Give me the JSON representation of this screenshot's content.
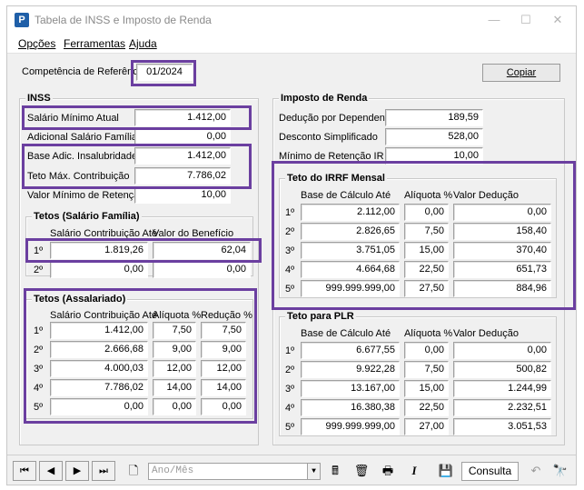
{
  "window": {
    "title": "Tabela de INSS e Imposto de Renda",
    "app_icon": "P",
    "minimize": "—",
    "maximize": "☐",
    "close": "✕"
  },
  "menu": [
    "Opções",
    "Ferramentas",
    "Ajuda"
  ],
  "competencia": {
    "label": "Competência de Referência",
    "value": "01/2024"
  },
  "copiar_label": "Copiar",
  "inss": {
    "title": "INSS",
    "fields": [
      {
        "label": "Salário Mínimo Atual",
        "value": "1.412,00"
      },
      {
        "label": "Adicional Salário Família",
        "value": "0,00"
      },
      {
        "label": "Base Adic. Insalubridade",
        "value": "1.412,00"
      },
      {
        "label": "Teto Máx. Contribuição",
        "value": "7.786,02"
      },
      {
        "label": "Valor Mínimo de Retenção",
        "value": "10,00"
      }
    ]
  },
  "tetos_familia": {
    "title": "Tetos (Salário Família)",
    "headers": [
      "Salário Contribuição Até",
      "Valor do Benefício"
    ],
    "rows": [
      {
        "idx": "1º",
        "salario": "1.819,26",
        "beneficio": "62,04"
      },
      {
        "idx": "2º",
        "salario": "0,00",
        "beneficio": "0,00"
      }
    ]
  },
  "tetos_assalariado": {
    "title": "Tetos (Assalariado)",
    "headers": [
      "Salário Contribuição Até",
      "Alíquota %",
      "Redução %"
    ],
    "rows": [
      {
        "idx": "1º",
        "salario": "1.412,00",
        "aliquota": "7,50",
        "reducao": "7,50"
      },
      {
        "idx": "2º",
        "salario": "2.666,68",
        "aliquota": "9,00",
        "reducao": "9,00"
      },
      {
        "idx": "3º",
        "salario": "4.000,03",
        "aliquota": "12,00",
        "reducao": "12,00"
      },
      {
        "idx": "4º",
        "salario": "7.786,02",
        "aliquota": "14,00",
        "reducao": "14,00"
      },
      {
        "idx": "5º",
        "salario": "0,00",
        "aliquota": "0,00",
        "reducao": "0,00"
      }
    ]
  },
  "imposto_renda": {
    "title": "Imposto de Renda",
    "fields": [
      {
        "label": "Dedução por Dependente",
        "value": "189,59"
      },
      {
        "label": "Desconto Simplificado",
        "value": "528,00"
      },
      {
        "label": "Mínimo de Retenção IR",
        "value": "10,00"
      }
    ]
  },
  "teto_irrf": {
    "title": "Teto do IRRF Mensal",
    "headers": [
      "Base de Cálculo Até",
      "Alíquota %",
      "Valor Dedução"
    ],
    "rows": [
      {
        "idx": "1º",
        "base": "2.112,00",
        "aliquota": "0,00",
        "deducao": "0,00"
      },
      {
        "idx": "2º",
        "base": "2.826,65",
        "aliquota": "7,50",
        "deducao": "158,40"
      },
      {
        "idx": "3º",
        "base": "3.751,05",
        "aliquota": "15,00",
        "deducao": "370,40"
      },
      {
        "idx": "4º",
        "base": "4.664,68",
        "aliquota": "22,50",
        "deducao": "651,73"
      },
      {
        "idx": "5º",
        "base": "999.999.999,00",
        "aliquota": "27,50",
        "deducao": "884,96"
      }
    ]
  },
  "teto_plr": {
    "title": "Teto para PLR",
    "headers": [
      "Base de Cálculo Até",
      "Alíquota %",
      "Valor Dedução"
    ],
    "rows": [
      {
        "idx": "1º",
        "base": "6.677,55",
        "aliquota": "0,00",
        "deducao": "0,00"
      },
      {
        "idx": "2º",
        "base": "9.922,28",
        "aliquota": "7,50",
        "deducao": "500,82"
      },
      {
        "idx": "3º",
        "base": "13.167,00",
        "aliquota": "15,00",
        "deducao": "1.244,99"
      },
      {
        "idx": "4º",
        "base": "16.380,38",
        "aliquota": "22,50",
        "deducao": "2.232,51"
      },
      {
        "idx": "5º",
        "base": "999.999.999,00",
        "aliquota": "27,00",
        "deducao": "3.051,53"
      }
    ]
  },
  "bottom": {
    "nav": [
      "⏮",
      "◀",
      "▶",
      "⏭"
    ],
    "combo_placeholder": "Ano/Mês",
    "combo_arrow": "▼",
    "consulta_label": "Consulta",
    "icons": {
      "new": "🗋",
      "calculator": "🖩",
      "cleaner": "🗑",
      "printer": "🖶",
      "italic": "I",
      "save": "💾",
      "undo": "↶",
      "binoculars": "🔭"
    }
  },
  "colors": {
    "highlight": "#6b3fa0",
    "field_bg": "#ffffff",
    "panel_bg": "#f0f0f0"
  }
}
